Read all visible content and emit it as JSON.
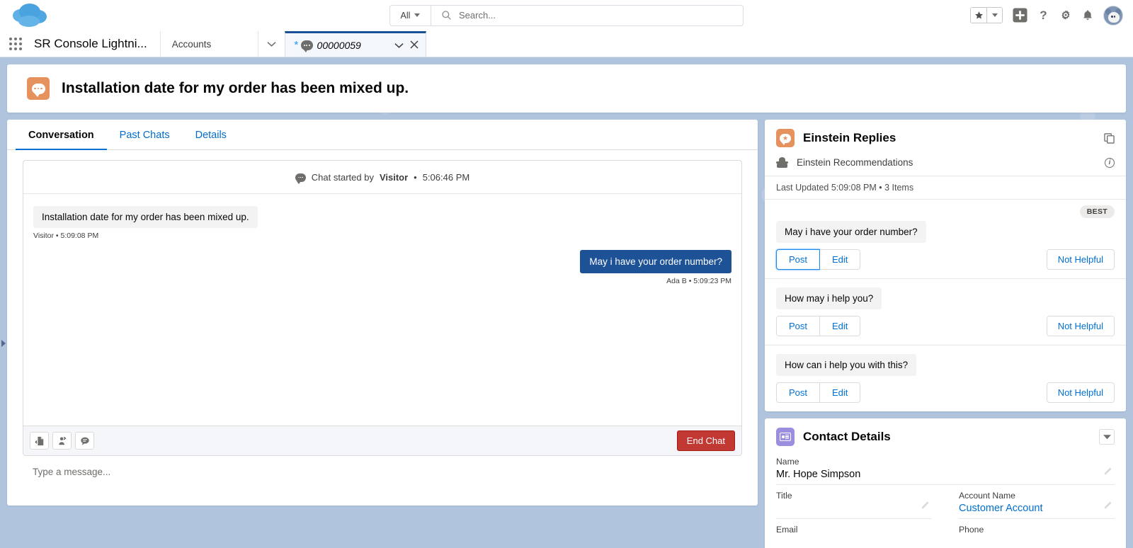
{
  "global_header": {
    "logo_name": "salesforce-cloud-logo",
    "search": {
      "scope": "All",
      "placeholder": "Search...",
      "value": ""
    },
    "actions": [
      {
        "name": "favorites-button",
        "icon": "star-icon"
      },
      {
        "name": "favorites-dropdown",
        "icon": "chevron-down-icon"
      },
      {
        "name": "global-add-button",
        "icon": "plus-icon"
      },
      {
        "name": "help-button",
        "icon": "question-mark-icon"
      },
      {
        "name": "setup-button",
        "icon": "gear-icon"
      },
      {
        "name": "notifications-button",
        "icon": "bell-icon"
      },
      {
        "name": "user-profile-button",
        "icon": "avatar-icon"
      }
    ]
  },
  "tab_bar": {
    "app_name": "SR Console Lightni...",
    "tabs": [
      {
        "label": "Accounts",
        "active": false
      },
      {
        "label": "00000059",
        "active": true,
        "dirty": "*",
        "icon": "chat-bubble-icon"
      }
    ],
    "overflow_icon": "chevron-down-icon",
    "tab_menu_icon": "chevron-down-icon",
    "tab_close_icon": "close-icon"
  },
  "case": {
    "title": "Installation date for my order has been mixed up.",
    "icon": "chat-case-icon"
  },
  "left_panel": {
    "tabs": [
      {
        "label": "Conversation",
        "active": true
      },
      {
        "label": "Past Chats",
        "active": false
      },
      {
        "label": "Details",
        "active": false
      }
    ],
    "chat_started": {
      "prefix": "Chat started by",
      "actor": "Visitor",
      "separator": "•",
      "time": "5:06:46 PM"
    },
    "messages": [
      {
        "text": "Installation date for my order has been mixed up.",
        "author": "Visitor",
        "time": "5:09:08 PM",
        "meta": "Visitor • 5:09:08 PM",
        "side": "visitor"
      },
      {
        "text": "May i have your order number?",
        "author": "Ada B",
        "time": "5:09:23 PM",
        "meta": "Ada B • 5:09:23 PM",
        "side": "agent"
      }
    ],
    "toolbar": [
      {
        "name": "transfer-file-icon"
      },
      {
        "name": "transfer-agent-icon"
      },
      {
        "name": "quick-text-icon"
      }
    ],
    "end_chat_label": "End Chat",
    "composer_placeholder": "Type a message...",
    "composer_value": ""
  },
  "einstein_panel": {
    "title": "Einstein Replies",
    "header_icon": "einstein-replies-icon",
    "copy_icon": "duplicate-icon",
    "subheader": "Einstein Recommendations",
    "subheader_icon": "einstein-head-icon",
    "info_icon": "info-icon",
    "last_updated": "Last Updated 5:09:08 PM • 3 Items",
    "best_badge": "BEST",
    "replies": [
      {
        "text": "May i have your order number?",
        "best": true,
        "post_label": "Post",
        "edit_label": "Edit",
        "not_helpful_label": "Not Helpful",
        "post_focused": true
      },
      {
        "text": "How may i help you?",
        "best": false,
        "post_label": "Post",
        "edit_label": "Edit",
        "not_helpful_label": "Not Helpful",
        "post_focused": false
      },
      {
        "text": "How can i help you with this?",
        "best": false,
        "post_label": "Post",
        "edit_label": "Edit",
        "not_helpful_label": "Not Helpful",
        "post_focused": false
      }
    ]
  },
  "contact_panel": {
    "title": "Contact Details",
    "icon": "contact-card-icon",
    "collapse_icon": "chevron-down-icon",
    "fields": {
      "name_label": "Name",
      "name_value": "Mr. Hope Simpson",
      "title_label": "Title",
      "title_value": "",
      "account_label": "Account Name",
      "account_value": "Customer Account",
      "email_label": "Email",
      "email_value": "",
      "phone_label": "Phone",
      "phone_value": ""
    }
  },
  "colors": {
    "brand_blue": "#0070d2",
    "active_tab_blue": "#1b5297",
    "agent_bubble": "#1d5297",
    "end_chat_red": "#c23934",
    "einstein_orange": "#e5925f",
    "contact_purple": "#9b8ede",
    "workspace_bg": "#b0c4de"
  }
}
